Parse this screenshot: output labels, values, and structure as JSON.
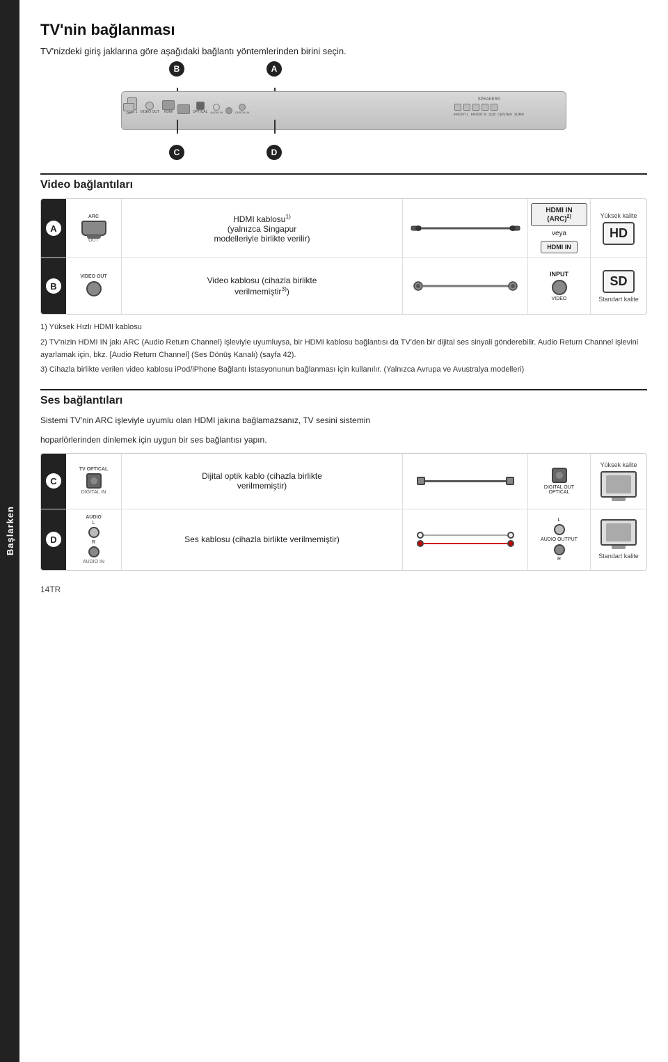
{
  "sidebar": {
    "label": "Başlarken"
  },
  "page": {
    "title": "TV'nin bağlanması",
    "intro": "TV'nizdeki giriş jaklarına göre aşağıdaki bağlantı yöntemlerinden birini seçin."
  },
  "video_section": {
    "title": "Video bağlantıları",
    "row_a": {
      "badge": "A",
      "source_top_label": "ARC",
      "source_bottom_label": "OUT",
      "desc_line1": "HDMI kablosu",
      "desc_sup": "1)",
      "desc_line2": "(yalnızca Singapur",
      "desc_line3": "modelleriyle birlikte verilir)",
      "tv_label1": "HDMI IN (ARC)",
      "tv_sup": "2)",
      "tv_label2": "veya",
      "tv_label3": "HDMI IN",
      "quality_label": "Yüksek kalite",
      "quality_badge": "HD"
    },
    "row_b": {
      "badge": "B",
      "source_label": "VIDEO OUT",
      "desc_line1": "Video kablosu (cihazla birlikte",
      "desc_line2": "verilmemiştir",
      "desc_sup": "3)",
      "desc_line3": ")",
      "tv_label": "INPUT",
      "tv_sub_label": "VIDEO",
      "quality_bottom": "Standart kalite",
      "quality_badge": "SD"
    }
  },
  "footnotes": {
    "note1": "1) Yüksek Hızlı HDMI kablosu",
    "note2": "2) TV'nizin HDMI IN jakı ARC (Audio Return Channel) işleviyle uyumluysa, bir HDMI kablosu bağlantısı da TV'den bir dijital ses sinyali gönderebilir. Audio Return Channel işlevini ayarlamak için, bkz. [Audio Return Channel] (Ses Dönüş Kanalı) (sayfa 42).",
    "note3": "3) Cihazla birlikte verilen video kablosu iPod/iPhone Bağlantı İstasyonunun bağlanması için kullanılır. (Yalnızca Avrupa ve Avustralya modelleri)"
  },
  "ses_section": {
    "title": "Ses bağlantıları",
    "intro_line1": "Sistemi TV'nin ARC işleviyle uyumlu olan HDMI jakına bağlamazsanız, TV sesini sistemin",
    "intro_line2": "hoparlörlerinden dinlemek için uygun bir ses bağlantısı yapın.",
    "row_c": {
      "badge": "C",
      "source_top_label": "TV OPTICAL",
      "source_bottom_label": "DIGITAL IN",
      "desc_line1": "Dijital optik kablo (cihazla birlikte",
      "desc_line2": "verilmemiştir)",
      "tv_label1": "DIGITAL OUT",
      "tv_label2": "OPTICAL",
      "quality_label": "Yüksek kalite"
    },
    "row_d": {
      "badge": "D",
      "source_top_label": "AUDIO",
      "source_sub1": "L",
      "source_sub2": "R",
      "source_bottom_label": "AUDIO IN",
      "desc_line1": "Ses kablosu (cihazla birlikte verilmemiştir)",
      "tv_label1": "L",
      "tv_label2": "AUDIO OUTPUT",
      "tv_label3": "R",
      "quality_bottom": "Standart kalite"
    }
  },
  "page_number": "14TR",
  "device_badges": {
    "b": "B",
    "a": "A",
    "c": "C",
    "d": "D"
  }
}
